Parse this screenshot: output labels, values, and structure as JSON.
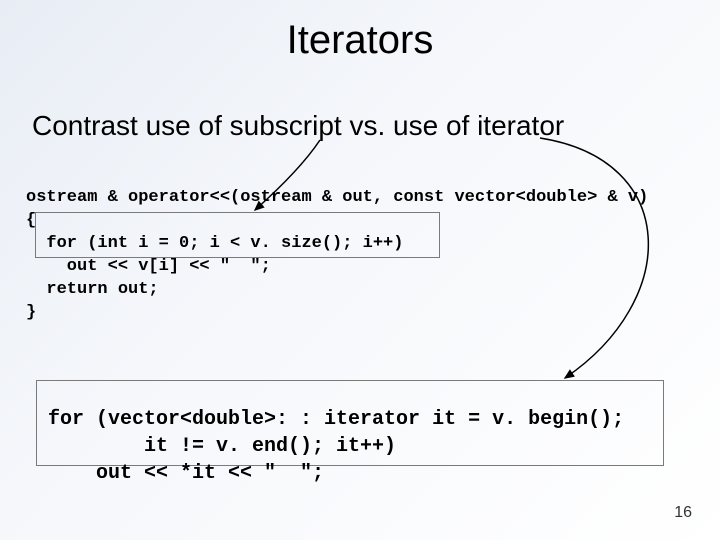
{
  "title": "Iterators",
  "subtitle": "Contrast use of subscript vs. use of iterator",
  "code1": "ostream & operator<<(ostream & out, const vector<double> & v)\n{\n  for (int i = 0; i < v. size(); i++)\n    out << v[i] << \"  \";\n  return out;\n}",
  "code2": "for (vector<double>: : iterator it = v. begin();\n        it != v. end(); it++)\n    out << *it << \"  \";",
  "page_number": "16"
}
